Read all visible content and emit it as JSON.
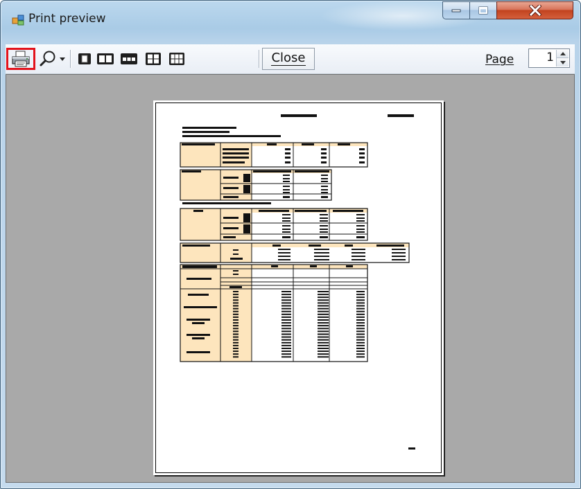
{
  "window": {
    "title": "Print preview",
    "buttons": {
      "minimize": "minimize",
      "maximize": "maximize",
      "close": "close"
    }
  },
  "toolbar": {
    "print_icon": "printer-icon",
    "zoom_icon": "magnifier-icon",
    "zoom_dropdown_icon": "chevron-down-icon",
    "page_layout_icons": [
      "one-page-icon",
      "two-pages-icon",
      "three-pages-icon",
      "four-pages-icon",
      "six-pages-icon"
    ],
    "close_label": "Close",
    "close_mnemonic": "C",
    "page_label": "Page",
    "page_value": "1"
  },
  "colors": {
    "print_highlight": "#e3121b",
    "preview_background": "#a9a9a9",
    "table_header_fill": "#fde5bd"
  }
}
